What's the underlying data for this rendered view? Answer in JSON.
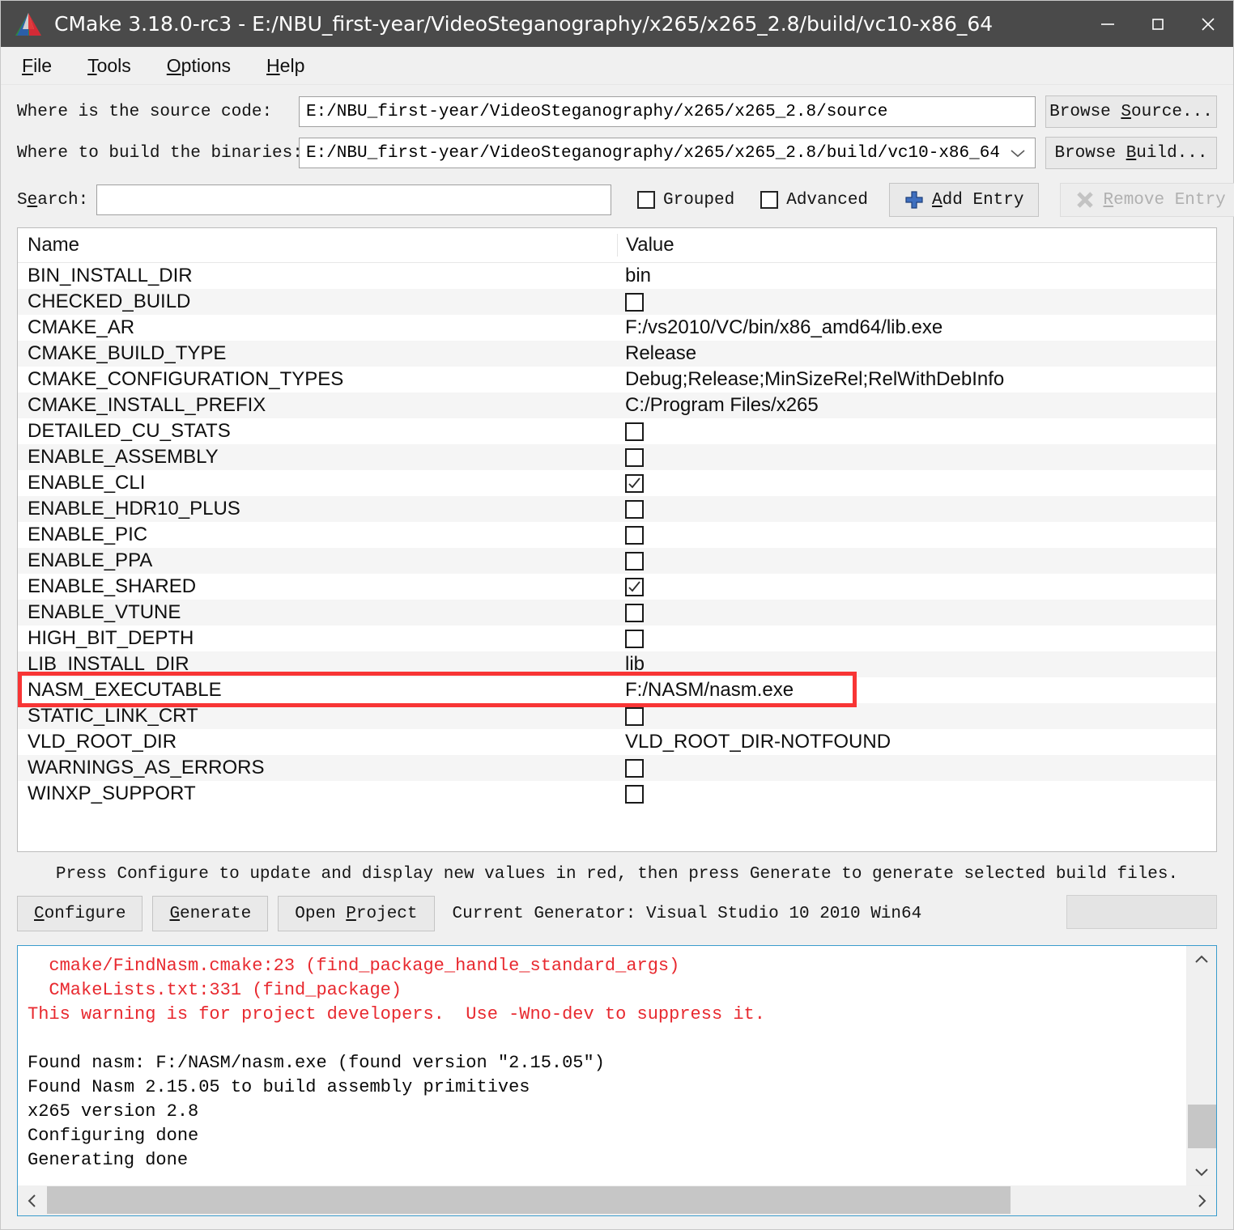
{
  "window": {
    "title": "CMake 3.18.0-rc3 - E:/NBU_first-year/VideoSteganography/x265/x265_2.8/build/vc10-x86_64",
    "logo_icon": "cmake-logo-icon",
    "minimize_icon": "minimize-icon",
    "maximize_icon": "maximize-icon",
    "close_icon": "close-icon",
    "accent_red": "#f83535",
    "titlebar_color": "#4a4a4a"
  },
  "menu": {
    "items": [
      {
        "label": "File",
        "mnemonic": "F"
      },
      {
        "label": "Tools",
        "mnemonic": "T"
      },
      {
        "label": "Options",
        "mnemonic": "O"
      },
      {
        "label": "Help",
        "mnemonic": "H"
      }
    ]
  },
  "paths": {
    "source_label": "Where is the source code:",
    "source_value": "E:/NBU_first-year/VideoSteganography/x265/x265_2.8/source",
    "browse_source_label": "Browse Source...",
    "build_label": "Where to build the binaries:",
    "build_value": "E:/NBU_first-year/VideoSteganography/x265/x265_2.8/build/vc10-x86_64",
    "browse_build_label": "Browse Build...",
    "combo_arrow_icon": "chevron-down-icon"
  },
  "search": {
    "label": "Search:",
    "value": "",
    "placeholder": ""
  },
  "toolbar": {
    "grouped_label": "Grouped",
    "grouped_checked": false,
    "advanced_label": "Advanced",
    "advanced_checked": false,
    "add_entry_label": "Add Entry",
    "add_entry_icon": "plus-icon",
    "remove_entry_label": "Remove Entry",
    "remove_entry_icon": "remove-x-icon",
    "remove_entry_disabled": true
  },
  "cache_table": {
    "headers": [
      "Name",
      "Value"
    ],
    "highlighted_row": "NASM_EXECUTABLE",
    "rows": [
      {
        "name": "BIN_INSTALL_DIR",
        "value": "bin",
        "type": "text"
      },
      {
        "name": "CHECKED_BUILD",
        "value": "",
        "type": "checkbox",
        "checked": false
      },
      {
        "name": "CMAKE_AR",
        "value": "F:/vs2010/VC/bin/x86_amd64/lib.exe",
        "type": "text"
      },
      {
        "name": "CMAKE_BUILD_TYPE",
        "value": "Release",
        "type": "text"
      },
      {
        "name": "CMAKE_CONFIGURATION_TYPES",
        "value": "Debug;Release;MinSizeRel;RelWithDebInfo",
        "type": "text"
      },
      {
        "name": "CMAKE_INSTALL_PREFIX",
        "value": "C:/Program Files/x265",
        "type": "text"
      },
      {
        "name": "DETAILED_CU_STATS",
        "value": "",
        "type": "checkbox",
        "checked": false
      },
      {
        "name": "ENABLE_ASSEMBLY",
        "value": "",
        "type": "checkbox",
        "checked": false
      },
      {
        "name": "ENABLE_CLI",
        "value": "",
        "type": "checkbox",
        "checked": true
      },
      {
        "name": "ENABLE_HDR10_PLUS",
        "value": "",
        "type": "checkbox",
        "checked": false
      },
      {
        "name": "ENABLE_PIC",
        "value": "",
        "type": "checkbox",
        "checked": false
      },
      {
        "name": "ENABLE_PPA",
        "value": "",
        "type": "checkbox",
        "checked": false
      },
      {
        "name": "ENABLE_SHARED",
        "value": "",
        "type": "checkbox",
        "checked": true
      },
      {
        "name": "ENABLE_VTUNE",
        "value": "",
        "type": "checkbox",
        "checked": false
      },
      {
        "name": "HIGH_BIT_DEPTH",
        "value": "",
        "type": "checkbox",
        "checked": false
      },
      {
        "name": "LIB_INSTALL_DIR",
        "value": "lib",
        "type": "text"
      },
      {
        "name": "NASM_EXECUTABLE",
        "value": "F:/NASM/nasm.exe",
        "type": "text"
      },
      {
        "name": "STATIC_LINK_CRT",
        "value": "",
        "type": "checkbox",
        "checked": false
      },
      {
        "name": "VLD_ROOT_DIR",
        "value": "VLD_ROOT_DIR-NOTFOUND",
        "type": "text"
      },
      {
        "name": "WARNINGS_AS_ERRORS",
        "value": "",
        "type": "checkbox",
        "checked": false
      },
      {
        "name": "WINXP_SUPPORT",
        "value": "",
        "type": "checkbox",
        "checked": false
      }
    ]
  },
  "status": {
    "hint": "Press Configure to update and display new values in red, then press Generate to generate selected build files."
  },
  "actions": {
    "configure_label": "Configure",
    "generate_label": "Generate",
    "open_project_label": "Open Project",
    "current_generator": "Current Generator: Visual Studio 10 2010 Win64"
  },
  "log": {
    "lines": [
      {
        "text": "  cmake/FindNasm.cmake:23 (find_package_handle_standard_args)",
        "color": "red"
      },
      {
        "text": "  CMakeLists.txt:331 (find_package)",
        "color": "red"
      },
      {
        "text": "This warning is for project developers.  Use -Wno-dev to suppress it.",
        "color": "red"
      },
      {
        "text": "",
        "color": "black"
      },
      {
        "text": "Found nasm: F:/NASM/nasm.exe (found version \"2.15.05\")",
        "color": "black"
      },
      {
        "text": "Found Nasm 2.15.05 to build assembly primitives",
        "color": "black"
      },
      {
        "text": "x265 version 2.8",
        "color": "black"
      },
      {
        "text": "Configuring done",
        "color": "black"
      },
      {
        "text": "Generating done",
        "color": "black"
      }
    ],
    "scroll_up_icon": "chevron-up-icon",
    "scroll_down_icon": "chevron-down-icon",
    "scroll_left_icon": "chevron-left-icon",
    "scroll_right_icon": "chevron-right-icon"
  }
}
